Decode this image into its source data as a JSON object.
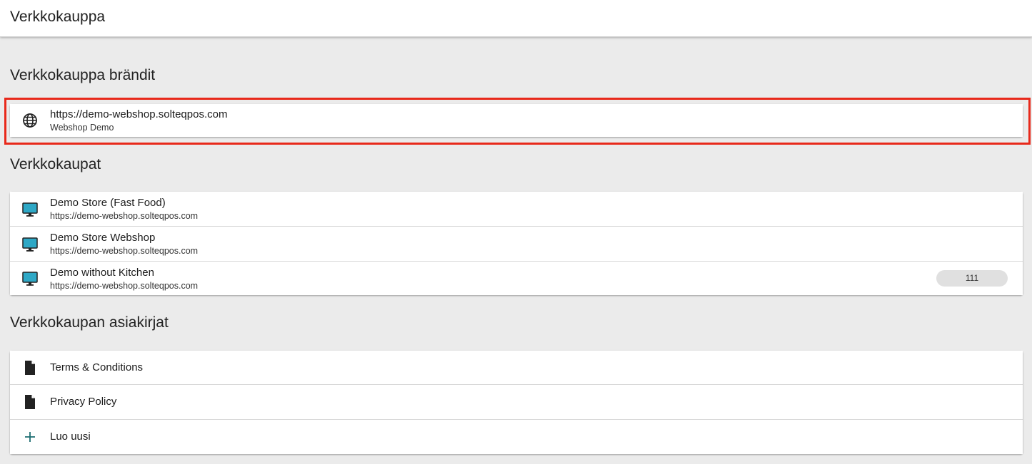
{
  "app_bar": {
    "title": "Verkkokauppa"
  },
  "brands": {
    "heading": "Verkkokauppa brändit",
    "items": [
      {
        "url": "https://demo-webshop.solteqpos.com",
        "name": "Webshop Demo",
        "icon": "globe-icon"
      }
    ]
  },
  "stores": {
    "heading": "Verkkokaupat",
    "items": [
      {
        "name": "Demo Store (Fast Food)",
        "url": "https://demo-webshop.solteqpos.com",
        "icon": "monitor-icon"
      },
      {
        "name": "Demo Store Webshop",
        "url": "https://demo-webshop.solteqpos.com",
        "icon": "monitor-icon"
      },
      {
        "name": "Demo without Kitchen",
        "url": "https://demo-webshop.solteqpos.com",
        "icon": "monitor-icon",
        "badge": "111"
      }
    ]
  },
  "documents": {
    "heading": "Verkkokaupan asiakirjat",
    "items": [
      {
        "label": "Terms & Conditions",
        "icon": "document-icon"
      },
      {
        "label": "Privacy Policy",
        "icon": "document-icon"
      },
      {
        "label": "Luo uusi",
        "icon": "plus-icon"
      }
    ]
  },
  "colors": {
    "highlight": "#e8291b",
    "monitor": "#2ea8c6",
    "plus": "#1f6f73"
  }
}
